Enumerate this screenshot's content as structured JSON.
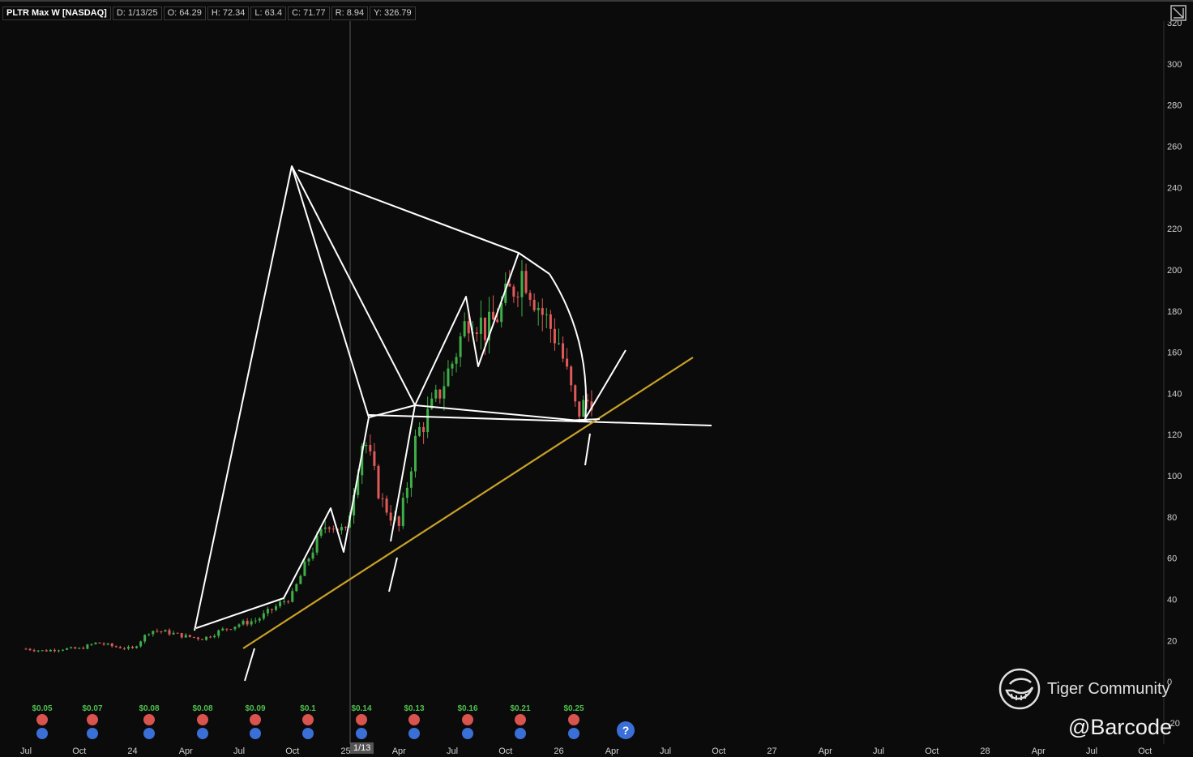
{
  "header": {
    "symbol": "PLTR Max W [NASDAQ]",
    "date": "D: 1/13/25",
    "open": "O: 64.29",
    "high": "H: 72.34",
    "low": "L: 63.4",
    "close": "C: 71.77",
    "range": "R: 8.94",
    "y": "Y: 326.79"
  },
  "crosshair_label": "1/13",
  "watermark": {
    "brand": "Tiger Community",
    "handle": "@Barcode"
  },
  "colors": {
    "up": "#3fae49",
    "down": "#e05a5a",
    "trendline": "#c9a227",
    "drawing": "#ffffff",
    "background": "#0b0b0b"
  },
  "chart_data": {
    "type": "candlestick",
    "title": "PLTR Max W [NASDAQ]",
    "xlabel": "",
    "ylabel": "",
    "ylim": [
      -20,
      320
    ],
    "y_ticks": [
      320,
      300,
      280,
      260,
      240,
      220,
      200,
      180,
      160,
      140,
      120,
      100,
      80,
      60,
      40,
      20,
      0,
      -20
    ],
    "x_ticks": [
      "Jul",
      "Oct",
      "24",
      "Apr",
      "Jul",
      "Oct",
      "25",
      "Apr",
      "Jul",
      "Oct",
      "26",
      "Apr",
      "Jul",
      "Oct",
      "27",
      "Apr",
      "Jul",
      "Oct",
      "28",
      "Apr",
      "Jul",
      "Oct"
    ],
    "price_path": [
      {
        "date": "2023-07",
        "price": 16
      },
      {
        "date": "2023-08",
        "price": 15
      },
      {
        "date": "2023-09",
        "price": 16
      },
      {
        "date": "2023-10",
        "price": 16
      },
      {
        "date": "2023-11",
        "price": 19
      },
      {
        "date": "2023-12",
        "price": 17
      },
      {
        "date": "2024-01",
        "price": 16
      },
      {
        "date": "2024-02",
        "price": 25
      },
      {
        "date": "2024-03",
        "price": 24
      },
      {
        "date": "2024-04",
        "price": 22
      },
      {
        "date": "2024-05",
        "price": 21
      },
      {
        "date": "2024-06",
        "price": 25
      },
      {
        "date": "2024-07",
        "price": 28
      },
      {
        "date": "2024-08",
        "price": 30
      },
      {
        "date": "2024-09",
        "price": 36
      },
      {
        "date": "2024-10",
        "price": 42
      },
      {
        "date": "2024-11",
        "price": 62
      },
      {
        "date": "2024-12",
        "price": 78
      },
      {
        "date": "2025-01",
        "price": 72
      },
      {
        "date": "2025-02",
        "price": 120
      },
      {
        "date": "2025-03",
        "price": 88
      },
      {
        "date": "2025-04",
        "price": 75
      },
      {
        "date": "2025-05",
        "price": 120
      },
      {
        "date": "2025-06",
        "price": 135
      },
      {
        "date": "2025-07",
        "price": 155
      },
      {
        "date": "2025-08",
        "price": 180
      },
      {
        "date": "2025-09",
        "price": 170
      },
      {
        "date": "2025-10",
        "price": 185
      },
      {
        "date": "2025-11",
        "price": 200
      },
      {
        "date": "2025-12",
        "price": 180
      },
      {
        "date": "2026-01",
        "price": 165
      },
      {
        "date": "2026-02",
        "price": 130
      },
      {
        "date": "2026-03",
        "price": 140
      }
    ],
    "events": {
      "eps_labels": [
        "$0.05",
        "$0.07",
        "$0.08",
        "$0.08",
        "$0.09",
        "$0.1",
        "$0.14",
        "$0.13",
        "$0.16",
        "$0.21",
        "$0.25"
      ],
      "help_marker": "?"
    }
  }
}
